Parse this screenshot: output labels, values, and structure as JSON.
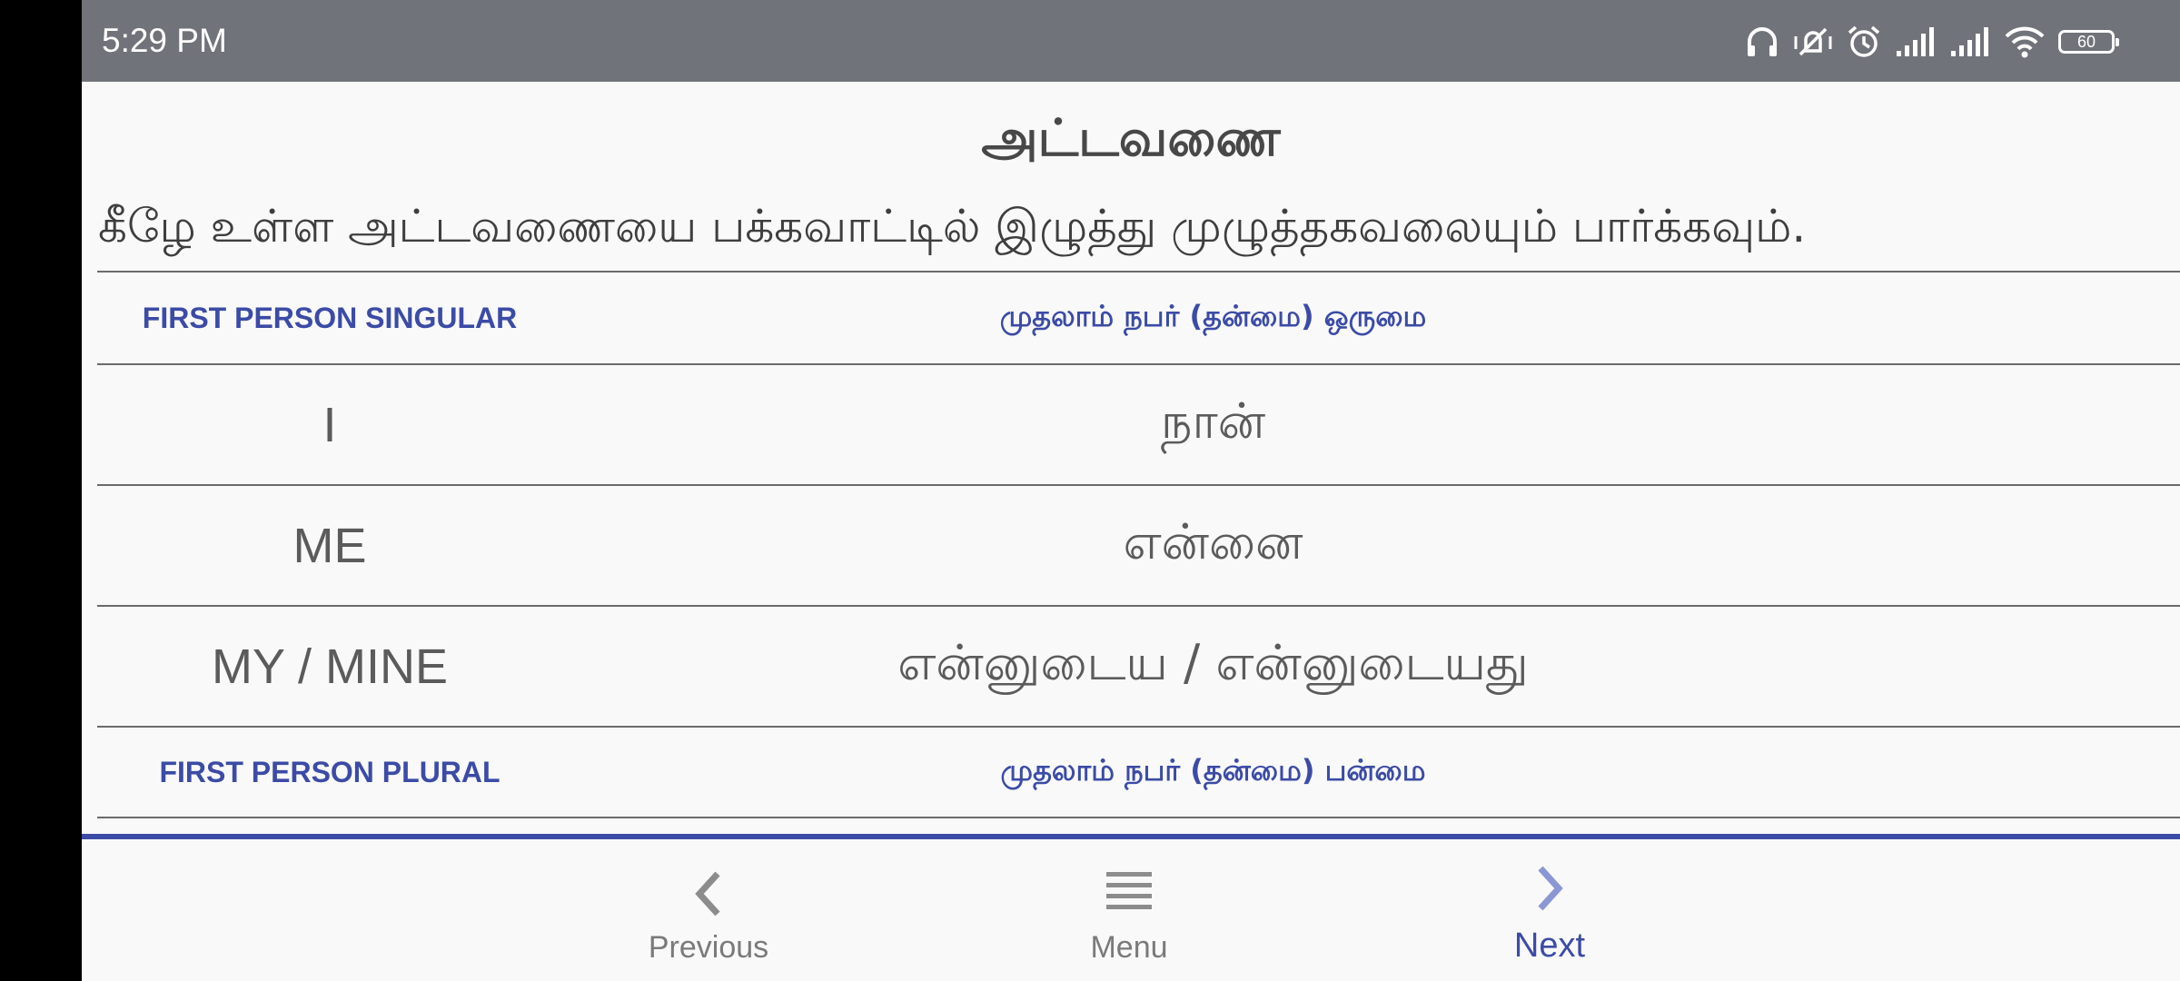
{
  "status_bar": {
    "time": "5:29 PM",
    "battery": "60",
    "icons": [
      "headset-icon",
      "mute-vibrate-icon",
      "alarm-icon",
      "signal-icon",
      "signal-icon",
      "wifi-icon",
      "battery-icon"
    ]
  },
  "page": {
    "title": "அட்டவணை",
    "instruction": "கீழே உள்ள அட்டவணையை பக்கவாட்டில் இழுத்து முழுத்தகவலையும் பார்க்கவும்."
  },
  "table": {
    "rows": [
      {
        "type": "header",
        "en": "FIRST PERSON SINGULAR",
        "ta": "முதலாம் நபர் (தன்மை) ஒருமை"
      },
      {
        "type": "data",
        "en": "I",
        "ta": "நான்"
      },
      {
        "type": "data",
        "en": "ME",
        "ta": "என்னை"
      },
      {
        "type": "data",
        "en": "MY / MINE",
        "ta": "என்னுடைய / என்னுடையது"
      },
      {
        "type": "header",
        "en": "FIRST PERSON PLURAL",
        "ta": "முதலாம் நபர் (தன்மை) பன்மை"
      }
    ]
  },
  "bottom_nav": {
    "previous_label": "Previous",
    "menu_label": "Menu",
    "next_label": "Next"
  },
  "colors": {
    "accent": "#3b4ba6",
    "status_bar": "#71737a",
    "background": "#f9f9f9"
  }
}
